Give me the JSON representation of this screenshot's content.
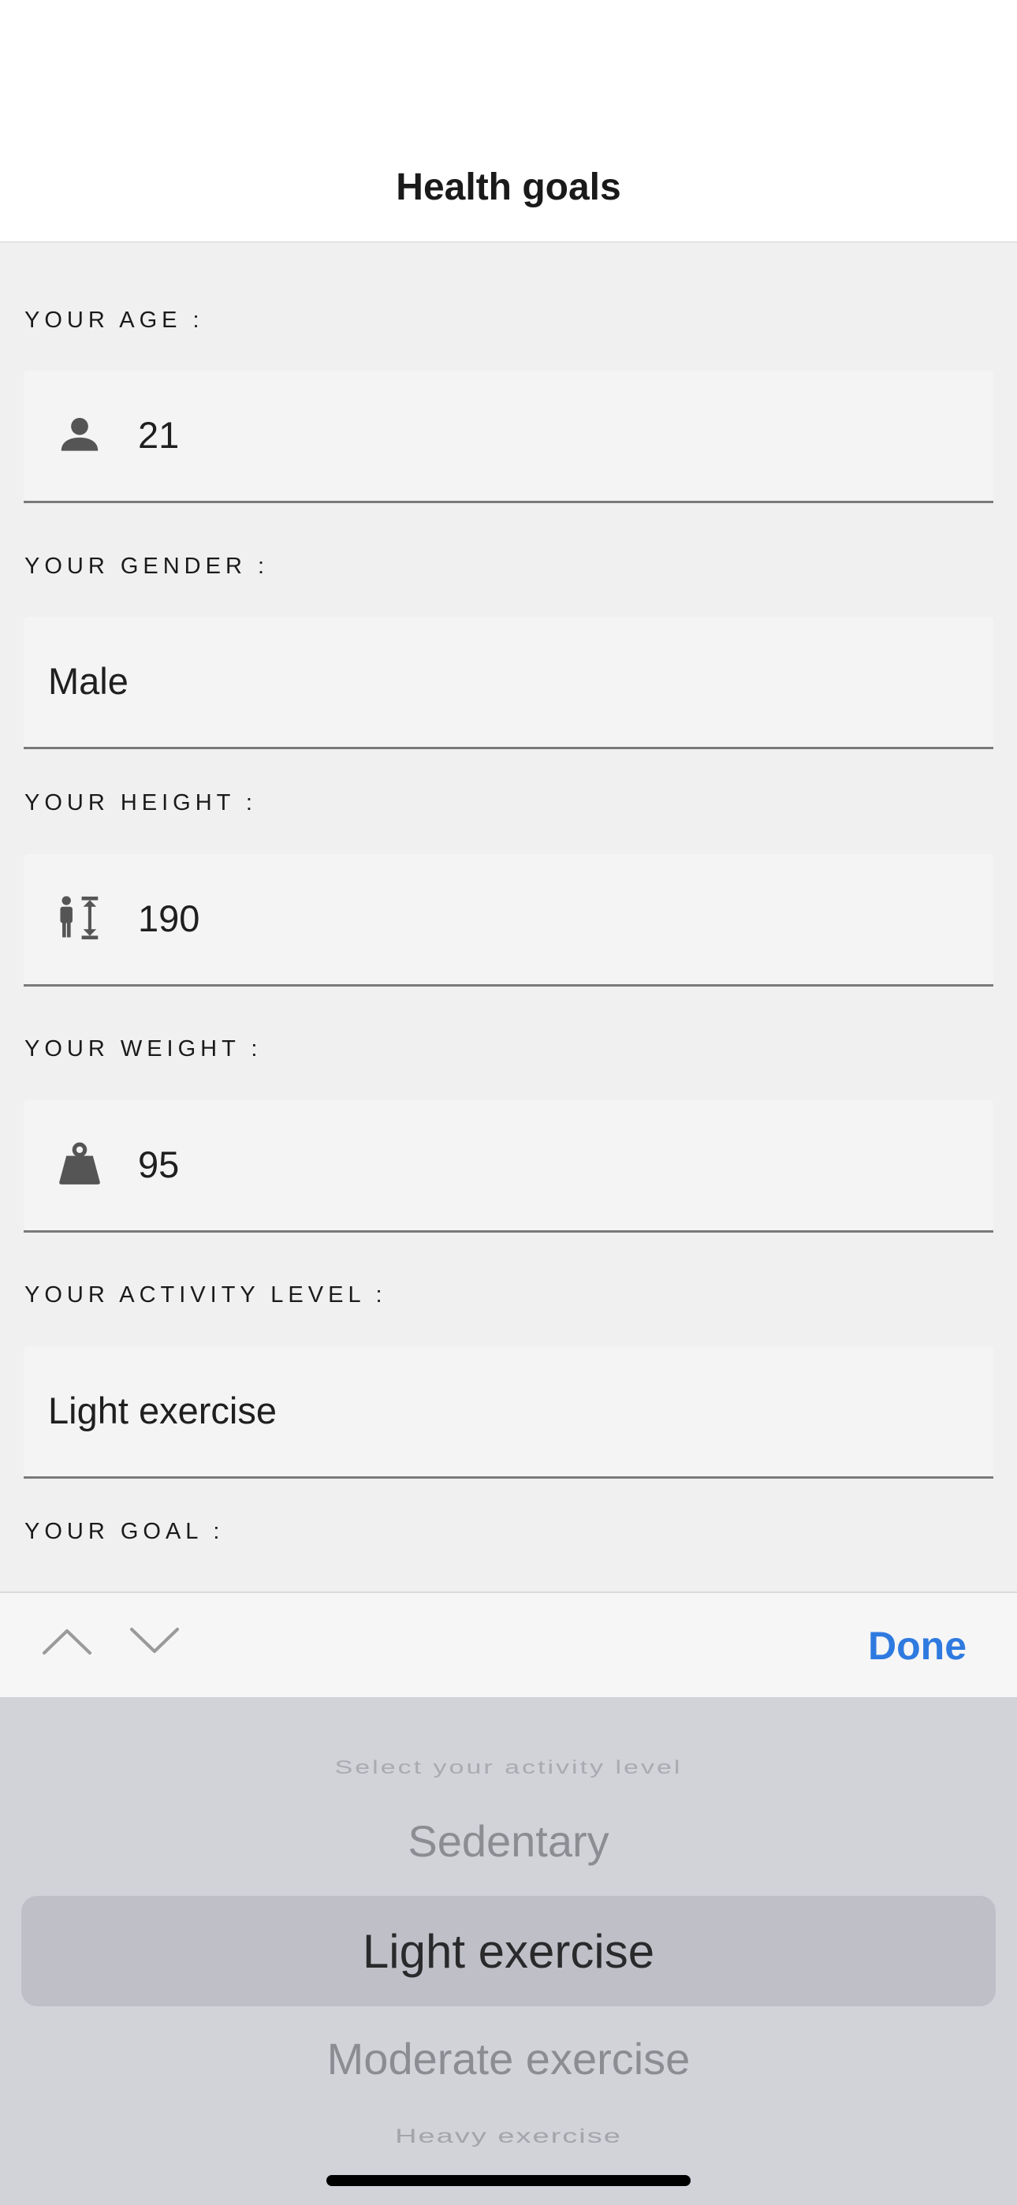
{
  "header": {
    "title": "Health goals"
  },
  "form": {
    "age": {
      "label": "YOUR AGE :",
      "value": "21",
      "icon": "person-icon"
    },
    "gender": {
      "label": "YOUR GENDER :",
      "value": "Male"
    },
    "height": {
      "label": "YOUR HEIGHT :",
      "value": "190",
      "icon": "height-icon"
    },
    "weight": {
      "label": "YOUR WEIGHT :",
      "value": "95",
      "icon": "weight-icon"
    },
    "activity": {
      "label": "YOUR ACTIVITY LEVEL :",
      "value": "Light exercise"
    },
    "goal": {
      "label": "YOUR GOAL :"
    }
  },
  "toolbar": {
    "done_label": "Done",
    "prev_icon": "chevron-up-icon",
    "next_icon": "chevron-down-icon"
  },
  "picker": {
    "options": [
      "Select your activity level",
      "Sedentary",
      "Light exercise",
      "Moderate exercise",
      "Heavy exercise"
    ],
    "selected": "Light exercise"
  },
  "colors": {
    "accent": "#2f7ae0",
    "picker_bg": "#d1d3d9",
    "field_bg": "#f4f4f4"
  }
}
